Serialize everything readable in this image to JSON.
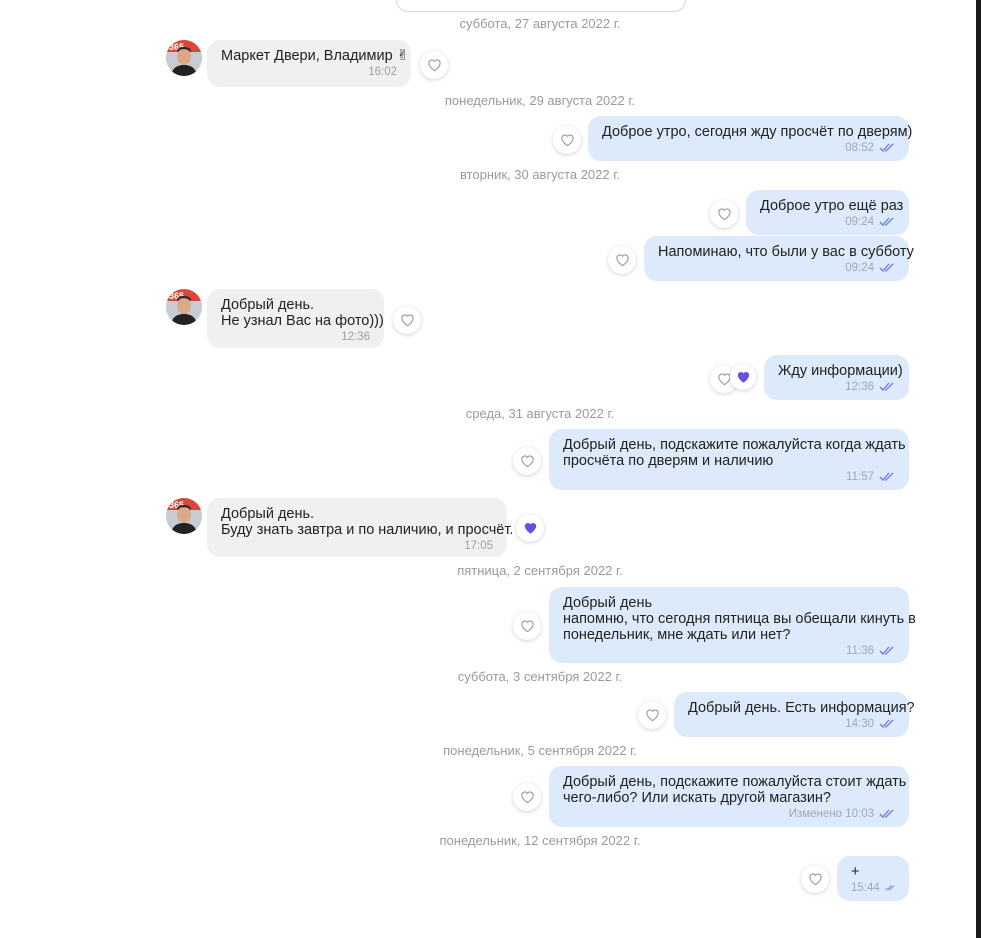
{
  "dates": [
    "суббота, 27 августа 2022 г.",
    "понедельник, 29 августа 2022 г.",
    "вторник, 30 августа 2022 г.",
    "среда, 31 августа 2022 г.",
    "пятница, 2 сентября 2022 г.",
    "суббота, 3 сентября 2022 г.",
    "понедельник, 5 сентября 2022 г.",
    "понедельник, 12 сентября 2022 г."
  ],
  "messages": [
    {
      "direction": "in",
      "lines": [
        "Маркет Двери, Владимир ✌"
      ],
      "time": "16:02",
      "reaction": "empty"
    },
    {
      "direction": "out",
      "lines": [
        "Доброе утро, сегодня жду просчёт по дверям)"
      ],
      "time": "08:52",
      "reaction": "empty"
    },
    {
      "direction": "out",
      "lines": [
        "Доброе утро ещё раз"
      ],
      "time": "09:24",
      "reaction": "empty"
    },
    {
      "direction": "out",
      "lines": [
        "Напоминаю, что были у вас в субботу"
      ],
      "time": "09:24",
      "reaction": "empty"
    },
    {
      "direction": "in",
      "lines": [
        "Добрый день.",
        "Не узнал Вас на фото)))"
      ],
      "time": "12:36",
      "reaction": "empty"
    },
    {
      "direction": "out",
      "lines": [
        "Жду информации)"
      ],
      "time": "12:36",
      "reaction": "empty+filled"
    },
    {
      "direction": "out",
      "lines": [
        "Добрый день, подскажите пожалуйста когда ждать",
        "просчёта по дверям и наличию"
      ],
      "time": "11:57",
      "reaction": "empty"
    },
    {
      "direction": "in",
      "lines": [
        "Добрый день.",
        "Буду знать завтра и по наличию, и просчёт."
      ],
      "time": "17:05",
      "reaction": "filled"
    },
    {
      "direction": "out",
      "lines": [
        "Добрый день",
        "напомню, что сегодня пятница вы обещали кинуть в",
        "понедельник, мне ждать или нет?"
      ],
      "time": "11:36",
      "reaction": "empty"
    },
    {
      "direction": "out",
      "lines": [
        "Добрый день. Есть информация?"
      ],
      "time": "14:30",
      "reaction": "empty"
    },
    {
      "direction": "out",
      "lines": [
        "Добрый день, подскажите пожалуйста стоит ждать",
        "чего-либо? Или искать другой магазин?"
      ],
      "time": "Изменено 10:03",
      "reaction": "empty"
    },
    {
      "direction": "out",
      "lines": [
        "+"
      ],
      "time": "15:44",
      "reaction": "empty"
    }
  ],
  "colors": {
    "incoming_bubble": "#f0f0f0",
    "outgoing_bubble": "#dceafc",
    "read_ticks": "#6a7de0",
    "reaction_heart": "#6b4fe0",
    "date_text": "#9a9a9a"
  },
  "icons": {
    "reaction": "heart-icon",
    "read": "double-check-icon",
    "avatar": "user-photo"
  }
}
